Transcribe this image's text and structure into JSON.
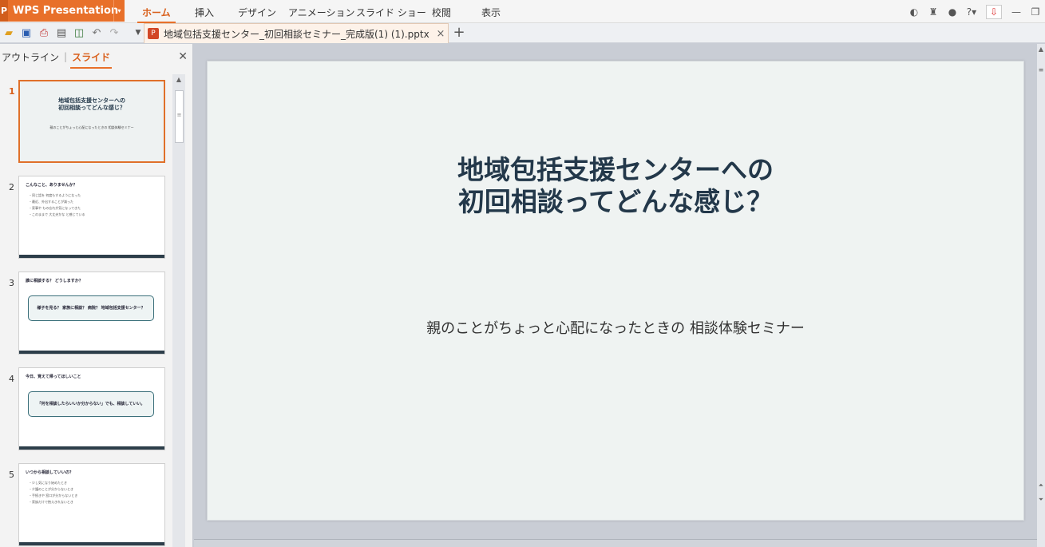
{
  "app": {
    "name": "WPS Presentation"
  },
  "menu": {
    "tabs": [
      "ホーム",
      "挿入",
      "デザイン",
      "アニメーション",
      "スライド ショー",
      "校閲",
      "表示"
    ],
    "active_index": 0
  },
  "document_tab": {
    "filename": "地域包括支援センター_初回相談セミナー_完成版(1) (1).pptx"
  },
  "left_panel": {
    "tab_outline": "アウトライン",
    "tab_slides": "スライド"
  },
  "slides": [
    {
      "number": "1",
      "title_line1": "地域包括支援センターへの",
      "title_line2": "初回相談ってどんな感じ？",
      "subtitle": "親のことがちょっと心配になったときの 相談体験セミナー"
    },
    {
      "number": "2",
      "heading": "こんなこと、ありませんか？",
      "bullets": [
        "・同じ話を 何度もするようになった",
        "・最近、外出することが減った",
        "・家事や もの忘れが気になってきた",
        "・このままで 大丈夫かな と感じている"
      ]
    },
    {
      "number": "3",
      "heading": "誰に相談する？ どうしますか？",
      "box": "様子を見る？ 家族に相談？ 病院？ 地域包括支援センター？"
    },
    {
      "number": "4",
      "heading": "今日、覚えて帰ってほしいこと",
      "box": "「何を相談したらいいか分からない」でも、相談していい。"
    },
    {
      "number": "5",
      "heading": "いつから相談していいの？",
      "bullets": [
        "・少し気になり始めたとき",
        "・介護のことが分からないとき",
        "・手続きや 窓口が分からないとき",
        "・家族だけで抱えきれないとき"
      ]
    }
  ],
  "main_slide": {
    "title_line1": "地域包括支援センターへの",
    "title_line2": "初回相談ってどんな感じ？",
    "subtitle": "親のことがちょっと心配になったときの 相談体験セミナー"
  },
  "colors": {
    "accent": "#e8702a",
    "title": "#23384a",
    "slide_bg": "#eff3f2"
  }
}
